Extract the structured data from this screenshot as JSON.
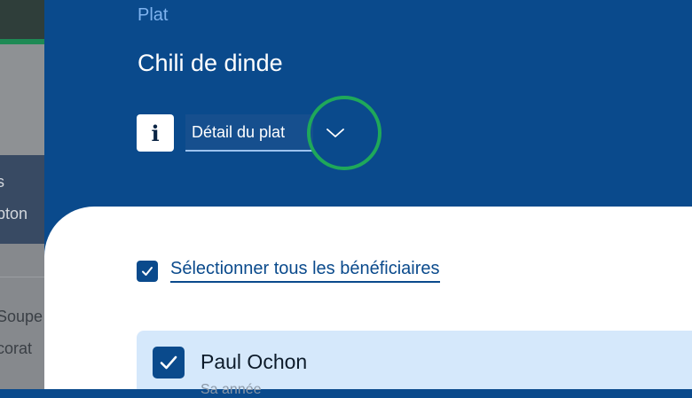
{
  "sidebar": {
    "text_fragments": [
      "s",
      "pton",
      "Soupe",
      "corat"
    ]
  },
  "header": {
    "category": "Plat",
    "dish_name": "Chili de dinde",
    "info_icon": "info-icon",
    "detail_select": {
      "label": "Détail du plat",
      "icon": "chevron-down-icon"
    }
  },
  "content": {
    "select_all": {
      "checked": true,
      "label": "Sélectionner tous les bénéficiaires"
    },
    "beneficiaries": [
      {
        "name": "Paul Ochon",
        "subtitle": "Sa année",
        "checked": true
      }
    ]
  },
  "colors": {
    "header_bg": "#0a4a8c",
    "accent_light": "#7fb3ef",
    "focus_ring": "#1fa85a",
    "row_highlight": "#d5e8fb"
  }
}
